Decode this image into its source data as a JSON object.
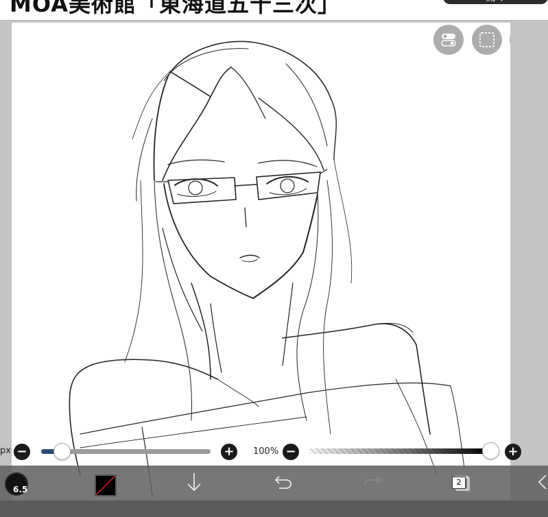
{
  "header": {
    "title": "MOA美術館「東海道五十三次」",
    "button_label": "開く"
  },
  "sliders": {
    "size_unit_label": "px",
    "size_value_fraction": 0.12,
    "opacity_label": "100%",
    "opacity_value_fraction": 1.0,
    "decrease_symbol": "−",
    "increase_symbol": "+"
  },
  "toolbar": {
    "brush_size": "6.5",
    "layer_count": "2"
  },
  "icons": {
    "toggle": "toggle-switch-icon",
    "selection": "dashed-selection-icon",
    "hand": "hand-touch-icon",
    "transfer_down": "arrow-down-icon",
    "undo": "undo-icon",
    "redo": "redo-icon",
    "layers": "layers-icon",
    "back": "back-arrow-icon"
  },
  "colors": {
    "slider_fill": "#2d4d78",
    "toolbar_bg": "#5f5f5f",
    "current_color": "#000000"
  }
}
